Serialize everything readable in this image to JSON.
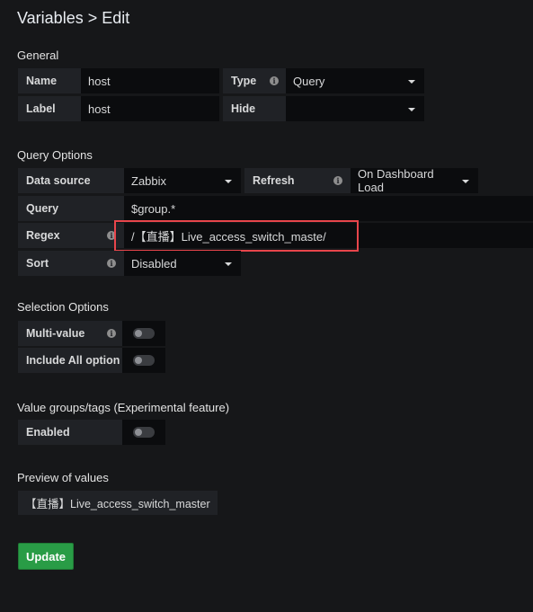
{
  "header": {
    "title": "Variables > Edit"
  },
  "general": {
    "heading": "General",
    "name_label": "Name",
    "name_value": "host",
    "type_label": "Type",
    "type_value": "Query",
    "label_label": "Label",
    "label_value": "host",
    "hide_label": "Hide",
    "hide_value": ""
  },
  "query_options": {
    "heading": "Query Options",
    "datasource_label": "Data source",
    "datasource_value": "Zabbix",
    "refresh_label": "Refresh",
    "refresh_value": "On Dashboard Load",
    "query_label": "Query",
    "query_value": "$group.*",
    "regex_label": "Regex",
    "regex_value": "/【直播】Live_access_switch_maste/",
    "sort_label": "Sort",
    "sort_value": "Disabled"
  },
  "selection_options": {
    "heading": "Selection Options",
    "multi_value_label": "Multi-value",
    "multi_value_enabled": false,
    "include_all_label": "Include All option",
    "include_all_enabled": false
  },
  "value_groups": {
    "heading": "Value groups/tags (Experimental feature)",
    "enabled_label": "Enabled",
    "enabled": false
  },
  "preview": {
    "heading": "Preview of values",
    "values": [
      "【直播】Live_access_switch_master"
    ]
  },
  "actions": {
    "update_label": "Update"
  },
  "colors": {
    "background": "#161719",
    "accent_green": "#299c46",
    "highlight_red": "#e8454b"
  }
}
